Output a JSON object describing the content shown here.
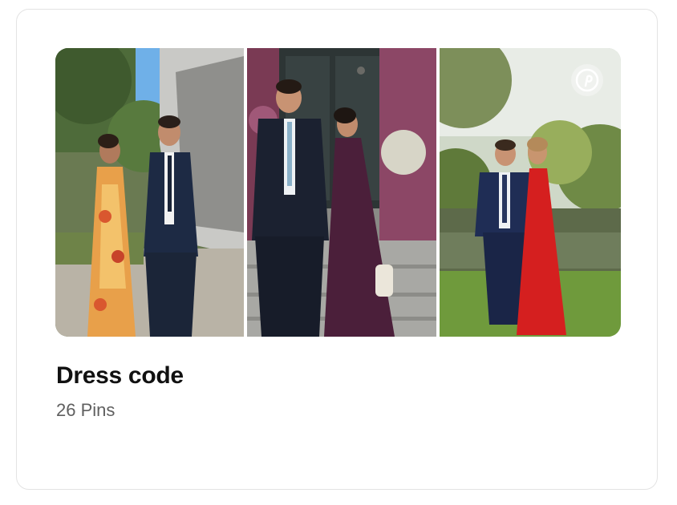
{
  "board": {
    "title": "Dress code",
    "pin_count": "26 Pins"
  },
  "collage": {
    "images": [
      {
        "icon": "couple-photo",
        "desc_colors": {
          "dress": "#e8a04a",
          "suit": "#1d2a44"
        }
      },
      {
        "icon": "couple-photo",
        "desc_colors": {
          "dress": "#4b1f3a",
          "suit": "#1b2130"
        }
      },
      {
        "icon": "couple-photo",
        "desc_colors": {
          "dress": "#d51f1f",
          "suit": "#1f2d55"
        }
      }
    ],
    "badge_icon": "pinterest-logo-icon"
  },
  "colors": {
    "title": "#111111",
    "subtitle": "#5f5f5f",
    "card_border": "#e3e3e3"
  }
}
